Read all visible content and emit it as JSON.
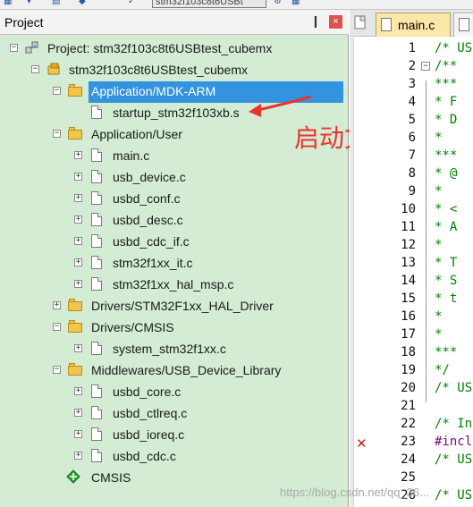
{
  "toolbar": {
    "target_combo": "stm32f103c8t6USBt"
  },
  "panel": {
    "title": "Project",
    "pin_glyph": "❙",
    "close_glyph": "×"
  },
  "tree": {
    "root": "Project: stm32f103c8t6USBtest_cubemx",
    "target": "stm32f103c8t6USBtest_cubemx",
    "groups": [
      {
        "label": "Application/MDK-ARM",
        "files": [
          "startup_stm32f103xb.s"
        ]
      },
      {
        "label": "Application/User",
        "files": [
          "main.c",
          "usb_device.c",
          "usbd_conf.c",
          "usbd_desc.c",
          "usbd_cdc_if.c",
          "stm32f1xx_it.c",
          "stm32f1xx_hal_msp.c"
        ]
      },
      {
        "label": "Drivers/STM32F1xx_HAL_Driver",
        "files": []
      },
      {
        "label": "Drivers/CMSIS",
        "files": [
          "system_stm32f1xx.c"
        ]
      },
      {
        "label": "Middlewares/USB_Device_Library",
        "files": [
          "usbd_core.c",
          "usbd_ctlreq.c",
          "usbd_ioreq.c",
          "usbd_cdc.c"
        ]
      }
    ],
    "cmsis": "CMSIS"
  },
  "annotation": {
    "text": "启动文件",
    "color": "#e8352b"
  },
  "editor": {
    "active_tab": "main.c",
    "lines": [
      {
        "n": "1",
        "code": "/* US"
      },
      {
        "n": "2",
        "code": "/**"
      },
      {
        "n": "3",
        "code": "  ***"
      },
      {
        "n": "4",
        "code": "  * F"
      },
      {
        "n": "5",
        "code": "  * D"
      },
      {
        "n": "6",
        "code": "  *"
      },
      {
        "n": "7",
        "code": "  ***"
      },
      {
        "n": "8",
        "code": "  * @"
      },
      {
        "n": "9",
        "code": "  *"
      },
      {
        "n": "10",
        "code": "  * <"
      },
      {
        "n": "11",
        "code": "  * A"
      },
      {
        "n": "12",
        "code": "  *"
      },
      {
        "n": "13",
        "code": "  * T"
      },
      {
        "n": "14",
        "code": "  * S"
      },
      {
        "n": "15",
        "code": "  * t"
      },
      {
        "n": "16",
        "code": "  *"
      },
      {
        "n": "17",
        "code": "  *"
      },
      {
        "n": "18",
        "code": "  ***"
      },
      {
        "n": "19",
        "code": "  */"
      },
      {
        "n": "20",
        "code": "/* US"
      },
      {
        "n": "21",
        "code": ""
      },
      {
        "n": "22",
        "code": "/* In"
      },
      {
        "n": "23",
        "code": "#incl"
      },
      {
        "n": "24",
        "code": "/* US"
      },
      {
        "n": "25",
        "code": ""
      },
      {
        "n": "26",
        "code": "/* US"
      }
    ],
    "error_glyph": "✕"
  },
  "watermark": "https://blog.csdn.net/qq_36..."
}
